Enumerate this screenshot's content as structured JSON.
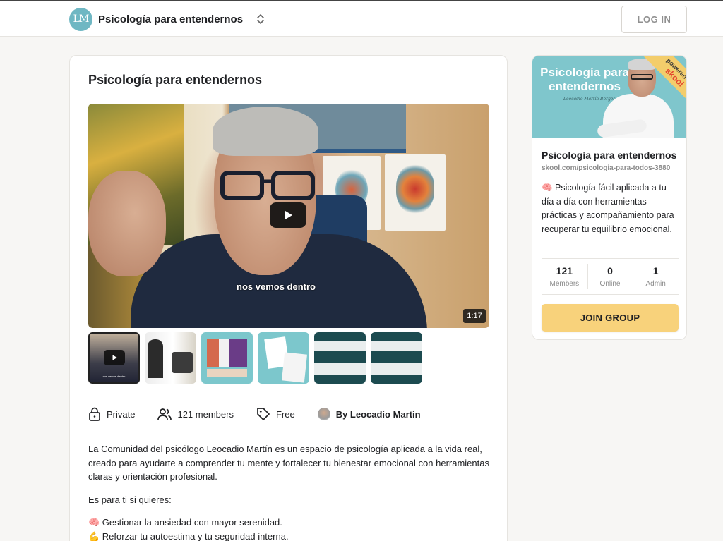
{
  "header": {
    "brand_initials": "LM",
    "brand_name": "Psicología para entendernos",
    "login_label": "LOG IN"
  },
  "main": {
    "title": "Psicología para entendernos",
    "video": {
      "caption": "nos vemos dentro",
      "duration": "1:17"
    },
    "thumbnails": [
      {
        "name": "thumb-video",
        "selected": true
      },
      {
        "name": "thumb-2",
        "selected": false
      },
      {
        "name": "thumb-3",
        "selected": false
      },
      {
        "name": "thumb-4",
        "selected": false
      },
      {
        "name": "thumb-5",
        "selected": false
      },
      {
        "name": "thumb-6",
        "selected": false
      }
    ],
    "meta": {
      "privacy": "Private",
      "members": "121 members",
      "price": "Free",
      "author": "By Leocadio Martin"
    },
    "description": {
      "intro_lines": [
        "La Comunidad del psicólogo Leocadio Martín es un espacio de psicología aplicada a la vida real,",
        "creado para ayudarte a comprender tu mente y fortalecer tu bienestar emocional con herramientas",
        "claras y orientación profesional."
      ],
      "para_ti": "Es para ti si quieres:",
      "bullets": [
        "🧠 Gestionar la ansiedad con mayor serenidad.",
        "💪 Reforzar tu autoestima y tu seguridad interna."
      ]
    }
  },
  "sidebar": {
    "banner": {
      "title": "Psicología para entendernos",
      "signature": "Leocadio Martín Borges",
      "ribbon_top": "powered by",
      "ribbon_brand": "skool"
    },
    "name": "Psicología para entendernos",
    "url": "skool.com/psicologia-para-todos-3880",
    "description": "🧠 Psicología fácil aplicada a tu día a día con herramientas prácticas y acompañamiento para recuperar tu equilibrio emocional.",
    "stats": [
      {
        "value": "121",
        "label": "Members"
      },
      {
        "value": "0",
        "label": "Online"
      },
      {
        "value": "1",
        "label": "Admin"
      }
    ],
    "join_label": "JOIN GROUP"
  },
  "colors": {
    "accent": "#f8d27b",
    "brand_teal": "#6fb7c3",
    "banner_teal": "#7fc6cc"
  }
}
